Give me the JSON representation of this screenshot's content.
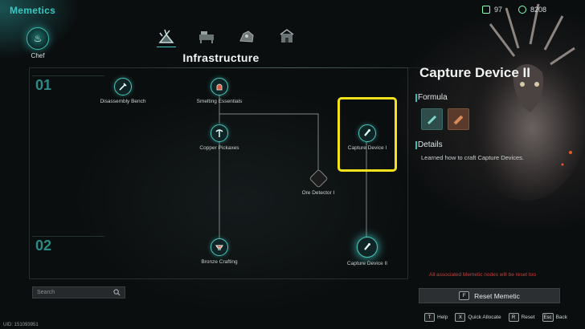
{
  "app": {
    "title": "Memetics"
  },
  "currencies": [
    {
      "icon": "memetic-point-icon",
      "value": "97"
    },
    {
      "icon": "coin-icon",
      "value": "8208"
    }
  ],
  "category": {
    "label": "Chef",
    "icon": "chef-hat-icon"
  },
  "tabs": [
    {
      "icon": "plant-icon",
      "active": true
    },
    {
      "icon": "workbench-icon",
      "active": false
    },
    {
      "icon": "ore-icon",
      "active": false
    },
    {
      "icon": "building-icon",
      "active": false
    }
  ],
  "section": {
    "title": "Infrastructure"
  },
  "tiers": [
    "01",
    "02"
  ],
  "nodes": [
    {
      "id": "disassembly-bench",
      "label": "Disassembly Bench"
    },
    {
      "id": "smelting-essentials",
      "label": "Smelting Essentials"
    },
    {
      "id": "copper-pickaxes",
      "label": "Copper Pickaxes"
    },
    {
      "id": "capture-device-1",
      "label": "Capture Device I"
    },
    {
      "id": "ore-detector-1",
      "label": "Ore Detector I"
    },
    {
      "id": "bronze-crafting",
      "label": "Bronze Crafting"
    },
    {
      "id": "capture-device-2",
      "label": "Capture Device II"
    }
  ],
  "detail": {
    "title": "Capture Device II",
    "formula_label": "Formula",
    "formula_items": [
      "teal-material-icon",
      "copper-material-icon"
    ],
    "details_label": "Details",
    "details_text": "Learned how to craft Capture Devices.",
    "warning": "All associated Memetic nodes will be reset too",
    "reset_key": "F",
    "reset_label": "Reset Memetic"
  },
  "hotkeys": [
    {
      "key": "T",
      "label": "Help"
    },
    {
      "key": "X",
      "label": "Quick Allocate"
    },
    {
      "key": "R",
      "label": "Reset"
    },
    {
      "key": "Esc",
      "label": "Back"
    }
  ],
  "search": {
    "placeholder": "Search"
  },
  "uid": "UID: 151093951",
  "colors": {
    "accent": "#38c9c2",
    "highlight": "#f4e21b",
    "warning": "#c2403c"
  }
}
